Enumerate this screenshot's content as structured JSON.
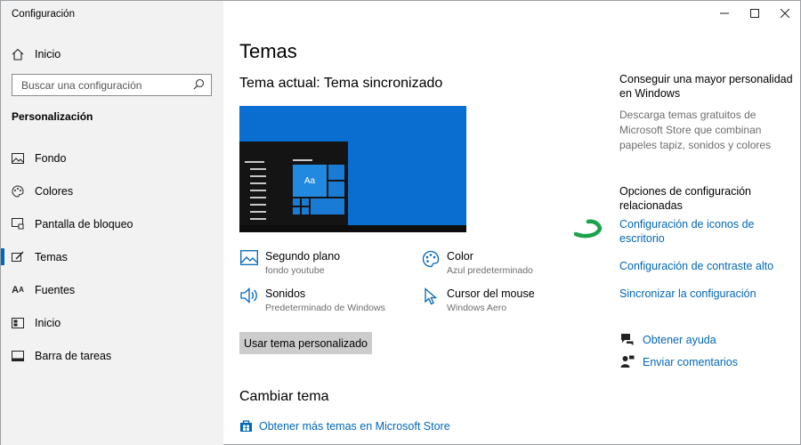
{
  "window": {
    "title": "Configuración"
  },
  "sidebar": {
    "home_label": "Inicio",
    "search_placeholder": "Buscar una configuración",
    "section_title": "Personalización",
    "items": [
      {
        "label": "Fondo",
        "icon": "picture-icon"
      },
      {
        "label": "Colores",
        "icon": "palette-icon"
      },
      {
        "label": "Pantalla de bloqueo",
        "icon": "lock-screen-icon"
      },
      {
        "label": "Temas",
        "icon": "brush-icon",
        "selected": true
      },
      {
        "label": "Fuentes",
        "icon": "font-icon"
      },
      {
        "label": "Inicio",
        "icon": "start-icon"
      },
      {
        "label": "Barra de tareas",
        "icon": "taskbar-icon"
      }
    ]
  },
  "main": {
    "title": "Temas",
    "current_theme": "Tema actual: Tema sincronizado",
    "preview": {
      "tile_label": "Aa"
    },
    "settings": {
      "background": {
        "title": "Segundo plano",
        "value": "fondo youtube"
      },
      "color": {
        "title": "Color",
        "value": "Azul predeterminado"
      },
      "sounds": {
        "title": "Sonidos",
        "value": "Predeterminado de Windows"
      },
      "cursor": {
        "title": "Cursor del mouse",
        "value": "Windows Aero"
      }
    },
    "custom_theme_button": "Usar tema personalizado",
    "change_theme_heading": "Cambiar tema",
    "store_link": "Obtener más temas en Microsoft Store"
  },
  "right": {
    "more_heading": "Conseguir una mayor personalidad en Windows",
    "more_text": "Descarga temas gratuitos de Microsoft Store que combinan papeles tapiz, sonidos y colores",
    "related_heading": "Opciones de configuración relacionadas",
    "links": [
      "Configuración de iconos de escritorio",
      "Configuración de contraste alto",
      "Sincronizar la configuración"
    ],
    "help": "Obtener ayuda",
    "feedback": "Enviar comentarios"
  },
  "colors": {
    "accent": "#0067b8",
    "annotation": "#1aa34a",
    "sidebar_bg": "#f2f2f2"
  }
}
